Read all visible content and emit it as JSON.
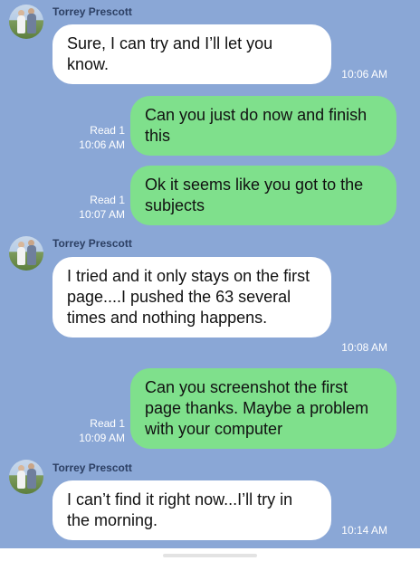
{
  "sender_name": "Torrey Prescott",
  "messages": [
    {
      "direction": "in",
      "text": "Sure, I can try and I’ll let you know.",
      "time": "10:06 AM"
    },
    {
      "direction": "out",
      "text": "Can you just do now and finish this",
      "read": "Read 1",
      "time": "10:06 AM"
    },
    {
      "direction": "out",
      "text": "Ok it seems like you got to the subjects",
      "read": "Read 1",
      "time": "10:07 AM"
    },
    {
      "direction": "in",
      "text": "I tried and it only stays on the first page....I pushed the 63 several times and nothing happens.",
      "time": "10:08 AM"
    },
    {
      "direction": "out",
      "text": "Can you screenshot the first page thanks. Maybe a problem with your computer",
      "read": "Read 1",
      "time": "10:09 AM"
    },
    {
      "direction": "in",
      "text": "I can’t find it right now...I’ll try in the morning.",
      "time": "10:14 AM"
    }
  ],
  "colors": {
    "background": "#8aa7d6",
    "incoming_bubble": "#ffffff",
    "outgoing_bubble": "#7fe08c"
  },
  "icons": {
    "avatar": "contact-avatar"
  }
}
